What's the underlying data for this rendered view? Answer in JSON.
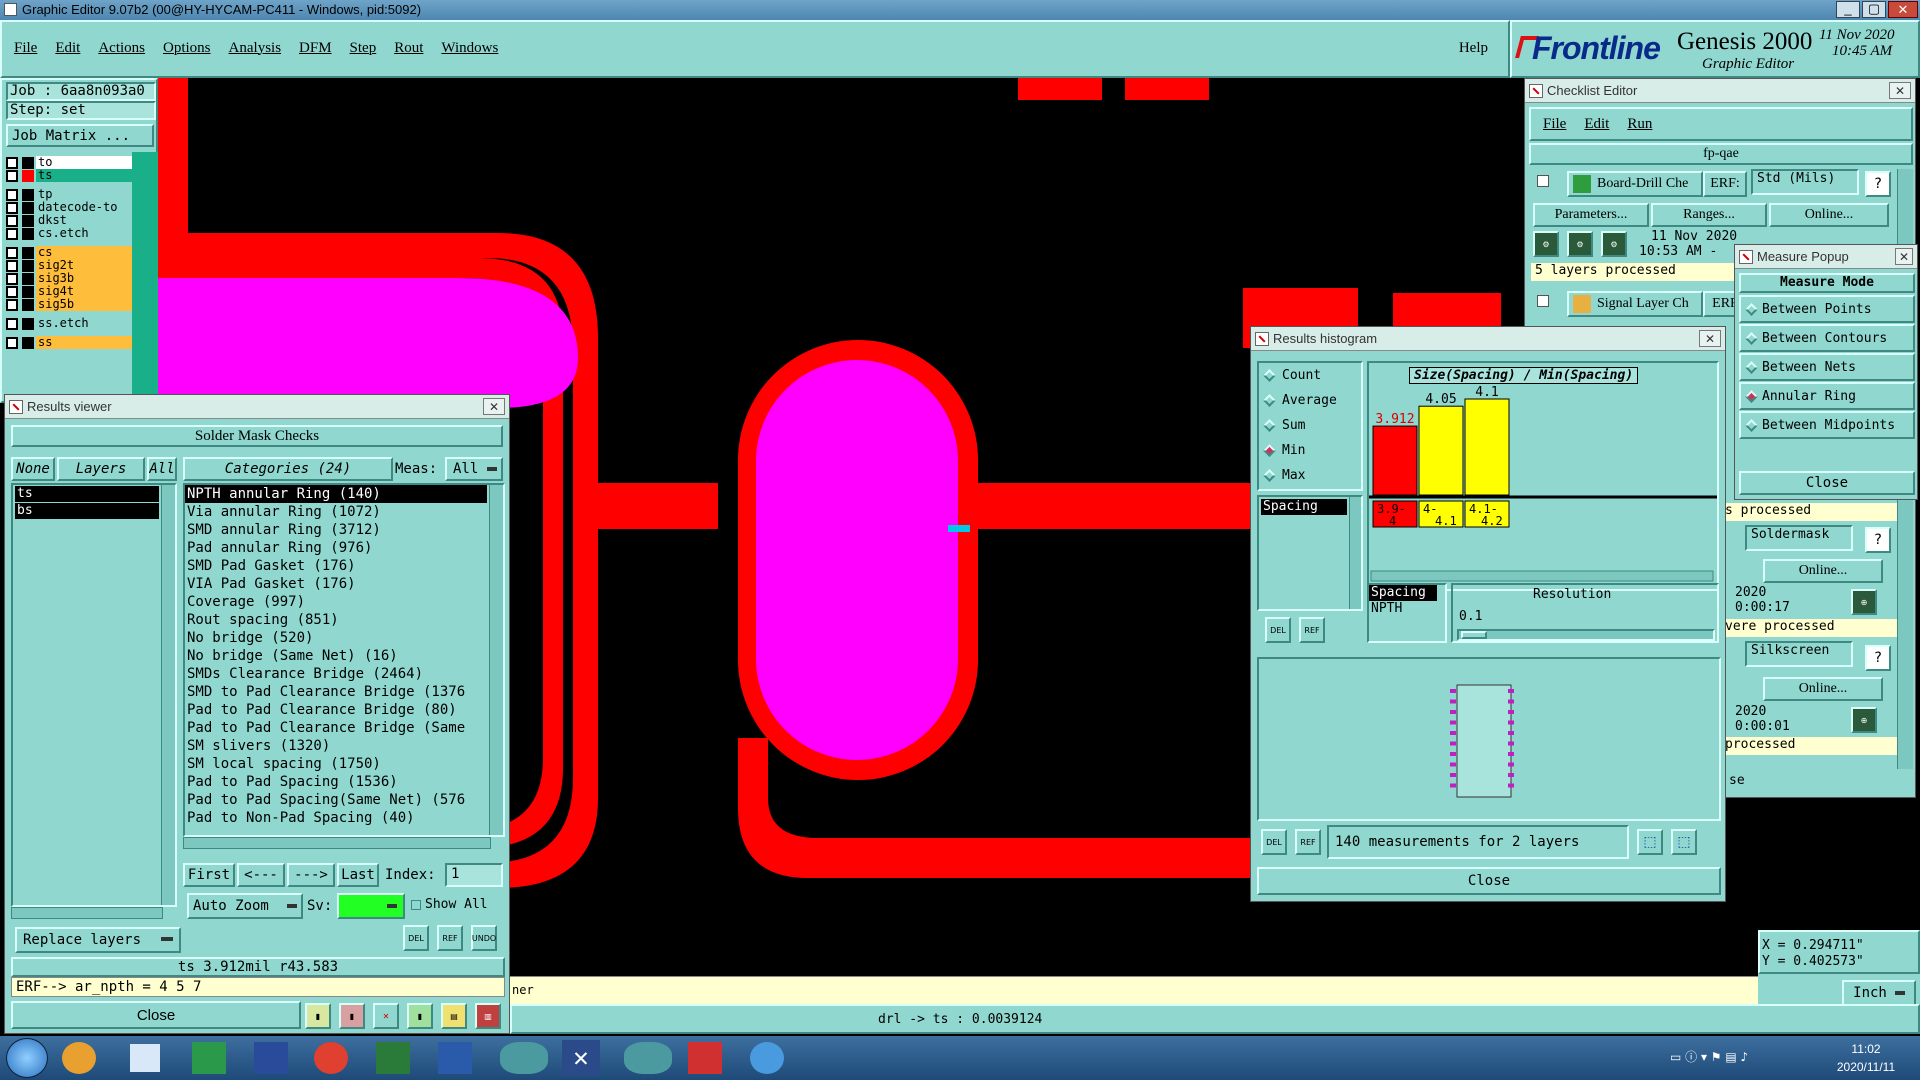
{
  "window": {
    "title": "Graphic Editor 9.07b2 (00@HY-HYCAM-PC411 - Windows, pid:5092)"
  },
  "menubar": {
    "items": [
      "File",
      "Edit",
      "Actions",
      "Options",
      "Analysis",
      "DFM",
      "Step",
      "Rout",
      "Windows"
    ],
    "help": "Help"
  },
  "brand": {
    "logo": "Frontline",
    "product": "Genesis 2000",
    "subtitle": "Graphic Editor",
    "date": "11 Nov 2020",
    "time": "10:45 AM"
  },
  "job": {
    "job": "Job : 6aa8n093a0",
    "step": "Step: set",
    "matrix": "Job Matrix ..."
  },
  "layers": [
    {
      "name": "to",
      "color": "#ffffff",
      "flag": "#000000"
    },
    {
      "name": "ts",
      "color": "#19b089",
      "flag": "#ff0000"
    },
    {
      "name": "tp",
      "color": "#8fd7cf",
      "flag": "#000000"
    },
    {
      "name": "datecode-to",
      "color": "#8fd7cf",
      "flag": "#000000"
    },
    {
      "name": "dkst",
      "color": "#8fd7cf",
      "flag": "#000000"
    },
    {
      "name": "cs.etch",
      "color": "#8fd7cf",
      "flag": "#000000"
    },
    {
      "name": "cs",
      "color": "#ffbd3c",
      "flag": "#000000"
    },
    {
      "name": "sig2t",
      "color": "#ffbd3c",
      "flag": "#000000"
    },
    {
      "name": "sig3b",
      "color": "#ffbd3c",
      "flag": "#000000"
    },
    {
      "name": "sig4t",
      "color": "#ffbd3c",
      "flag": "#000000"
    },
    {
      "name": "sig5b",
      "color": "#ffbd3c",
      "flag": "#000000"
    },
    {
      "name": "ss.etch",
      "color": "#8fd7cf",
      "flag": "#000000"
    },
    {
      "name": "ss",
      "color": "#ffbd3c",
      "flag": "#000000"
    }
  ],
  "results_viewer": {
    "title": "Results viewer",
    "header": "Solder Mask Checks",
    "none": "None",
    "layers": "Layers",
    "all": "All",
    "categories_label": "Categories (24)",
    "meas_label": "Meas:",
    "meas_value": "All",
    "layer_items": [
      "ts",
      "bs"
    ],
    "categories": [
      "NPTH annular Ring (140)",
      "Via annular Ring (1072)",
      "SMD annular Ring (3712)",
      "Pad annular Ring (976)",
      "SMD Pad Gasket (176)",
      "VIA Pad Gasket (176)",
      "Coverage (997)",
      "Rout spacing (851)",
      "No bridge (520)",
      "No bridge (Same Net) (16)",
      "SMDs Clearance Bridge (2464)",
      "SMD to Pad Clearance Bridge (1376",
      "Pad to Pad Clearance Bridge (80)",
      "Pad to Pad Clearance Bridge (Same",
      "SM slivers (1320)",
      "SM local spacing (1750)",
      "Pad to Pad Spacing (1536)",
      "Pad to Pad Spacing(Same Net) (576",
      "Pad to Non-Pad Spacing (40)"
    ],
    "nav": {
      "first": "First",
      "prev": "<---",
      "next": "--->",
      "last": "Last",
      "index_label": "Index:",
      "index_value": "1"
    },
    "auto_zoom": "Auto Zoom",
    "sv_label": "Sv:",
    "show_all": "Show All",
    "replace_layers": "Replace layers",
    "status": "ts 3.912mil  r43.583",
    "erf": "ERF--> ar_npth = 4 5 7",
    "close": "Close",
    "del": "DEL",
    "ref": "REF",
    "undo": "UNDO"
  },
  "checklist": {
    "title": "Checklist Editor",
    "menu": [
      "File",
      "Edit",
      "Run"
    ],
    "name": "fp-qae",
    "check1": {
      "name": "Board-Drill Che",
      "erf": "ERF:",
      "std": "Std (Mils)",
      "params": "Parameters...",
      "ranges": "Ranges...",
      "online": "Online...",
      "date": "11 Nov 2020",
      "time": "10:53 AM -",
      "status": "5 layers processed"
    },
    "check2": {
      "name": "Signal Layer Ch",
      "erf": "ERF"
    },
    "frag": {
      "processed": "s processed",
      "soldermask": "Soldermask",
      "online1": "Online...",
      "date1": "2020",
      "time1": "0:00:17",
      "were": "vere processed",
      "silkscreen": "Silkscreen",
      "online2": "Online...",
      "date2": "2020",
      "time2": "0:00:01",
      "processed2": "processed",
      "se": "se",
      "q": "?"
    }
  },
  "measure": {
    "title": "Measure Popup",
    "mode": "Measure Mode",
    "options": [
      "Between Points",
      "Between Contours",
      "Between Nets",
      "Annular Ring",
      "Between Midpoints"
    ],
    "selected": 3,
    "close": "Close"
  },
  "histogram": {
    "title": "Results histogram",
    "stats": [
      "Count",
      "Average",
      "Sum",
      "Min",
      "Max"
    ],
    "selected": 3,
    "list_items": [
      "Spacing"
    ],
    "info_items": [
      "Spacing",
      "NPTH"
    ],
    "resolution_label": "Resolution",
    "resolution_value": "0.1",
    "measurements": "140 measurements for 2 layers",
    "close": "Close",
    "del": "DEL",
    "ref": "REF"
  },
  "chart_data": {
    "type": "bar",
    "title": "Size(Spacing) / Min(Spacing)",
    "categories": [
      "3.9-4",
      "4-4.1",
      "4.1-4.2"
    ],
    "values": [
      3.912,
      4.05,
      4.1
    ],
    "value_labels": [
      "3.912",
      "4.05",
      "4.1"
    ],
    "bar_colors": [
      "#ff0000",
      "#ffff00",
      "#ffff00"
    ]
  },
  "coords": {
    "x": "X = 0.294711\"",
    "y": "Y = 0.402573\""
  },
  "units": "Inch",
  "status_bar": {
    "left": "ner",
    "center": "drl -> ts : 0.0039124"
  },
  "taskbar": {
    "time": "11:02",
    "date": "2020/11/11"
  },
  "colors": {
    "pad": "#ff00ff",
    "trace": "#ff0000",
    "ui": "#8fd7cf"
  }
}
